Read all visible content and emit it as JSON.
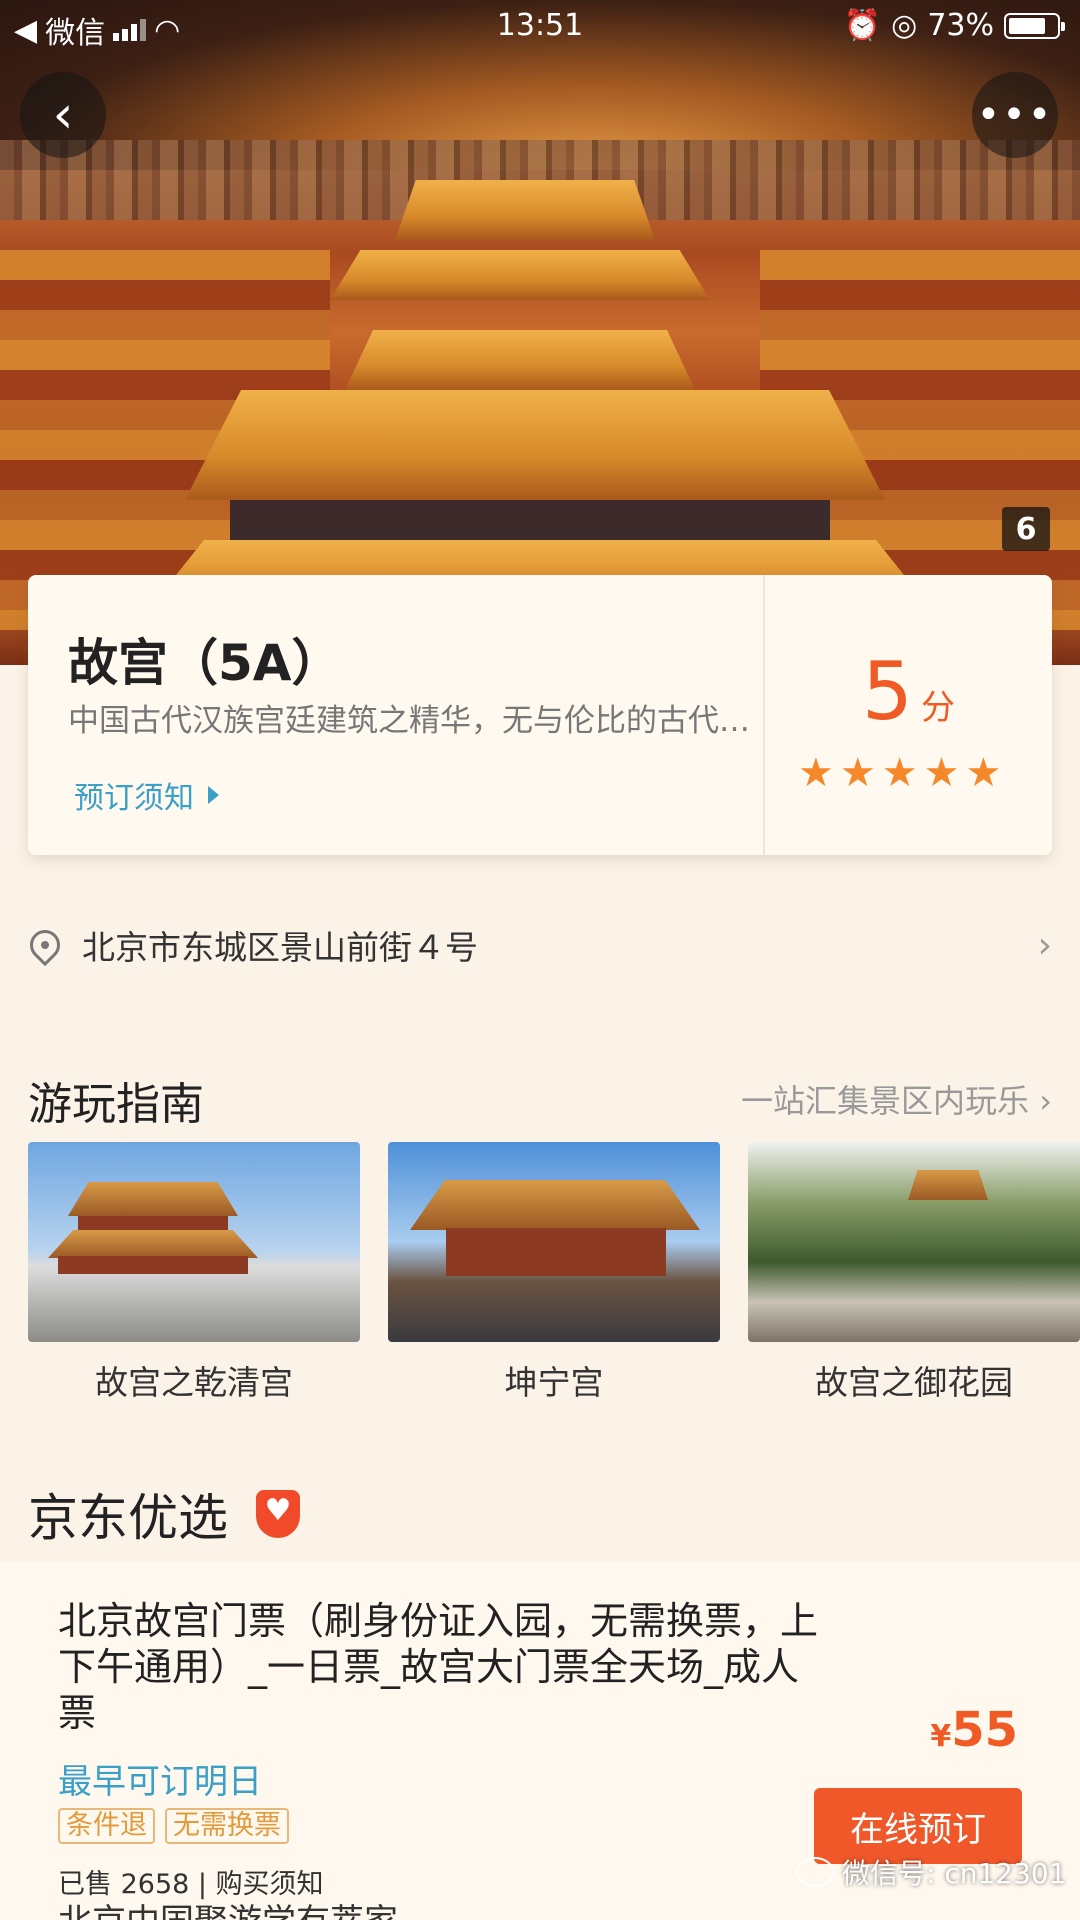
{
  "status_bar": {
    "back_app": "微信",
    "time": "13:51",
    "battery": "73%"
  },
  "hero": {
    "photo_count": "6"
  },
  "attraction": {
    "title": "故宫（5A）",
    "description": "中国古代汉族宫廷建筑之精华，无与伦比的古代建筑杰作",
    "notice_link": "预订须知",
    "score": "5",
    "score_unit": "分",
    "stars": 5
  },
  "address": {
    "text": "北京市东城区景山前街４号"
  },
  "guide": {
    "title": "游玩指南",
    "more": "一站汇集景区内玩乐",
    "items": [
      {
        "caption": "故宫之乾清宫"
      },
      {
        "caption": "坤宁宫"
      },
      {
        "caption": "故宫之御花园"
      }
    ]
  },
  "jd": {
    "title": "京东优选"
  },
  "product": {
    "name": "北京故宫门票（刷身份证入园，无需换票，上下午通用）_一日票_故宫大门票全天场_成人票",
    "earliest": "最早可订明日",
    "tags": [
      "条件退",
      "无需换票"
    ],
    "sold": "已售 2658",
    "buy_notice": "购买须知",
    "currency": "¥",
    "price": "55",
    "book_button": "在线预订",
    "next_item": "北京中国聚游学有萃家"
  },
  "watermark": {
    "text": "微信号: cn12301"
  },
  "colors": {
    "accent": "#f05a24",
    "link": "#3aa0c8",
    "star": "#f5892a",
    "background": "#fbf3e8"
  }
}
